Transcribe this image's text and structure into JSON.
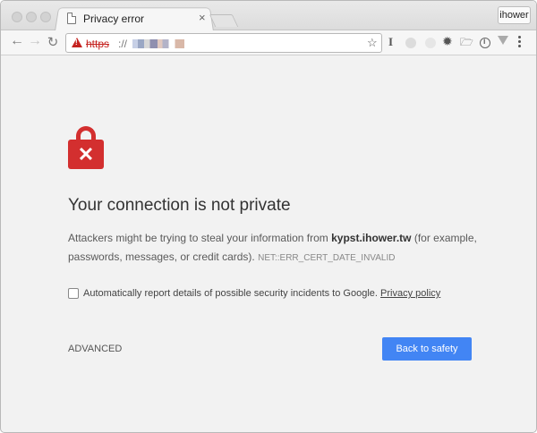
{
  "tab": {
    "title": "Privacy error",
    "close": "×"
  },
  "profile": {
    "name": "ihower"
  },
  "toolbar": {
    "back_icon": "arrow-left-icon",
    "forward_icon": "arrow-right-icon",
    "reload_icon": "reload-icon"
  },
  "omnibox": {
    "scheme": "https",
    "separator": "://",
    "security_state": "not-secure",
    "bookmark_icon": "☆"
  },
  "page": {
    "heading": "Your connection is not private",
    "body_prefix": "Attackers might be trying to steal your information from ",
    "domain": "kypst.ihower.tw",
    "body_suffix": " (for example, passwords, messages, or credit cards).",
    "error_code": "NET::ERR_CERT_DATE_INVALID",
    "report_text": "Automatically report details of possible security incidents to Google.",
    "privacy_link": "Privacy policy",
    "advanced_label": "ADVANCED",
    "safety_label": "Back to safety"
  },
  "colors": {
    "danger": "#d32f2f",
    "primary_button": "#4285f4"
  }
}
